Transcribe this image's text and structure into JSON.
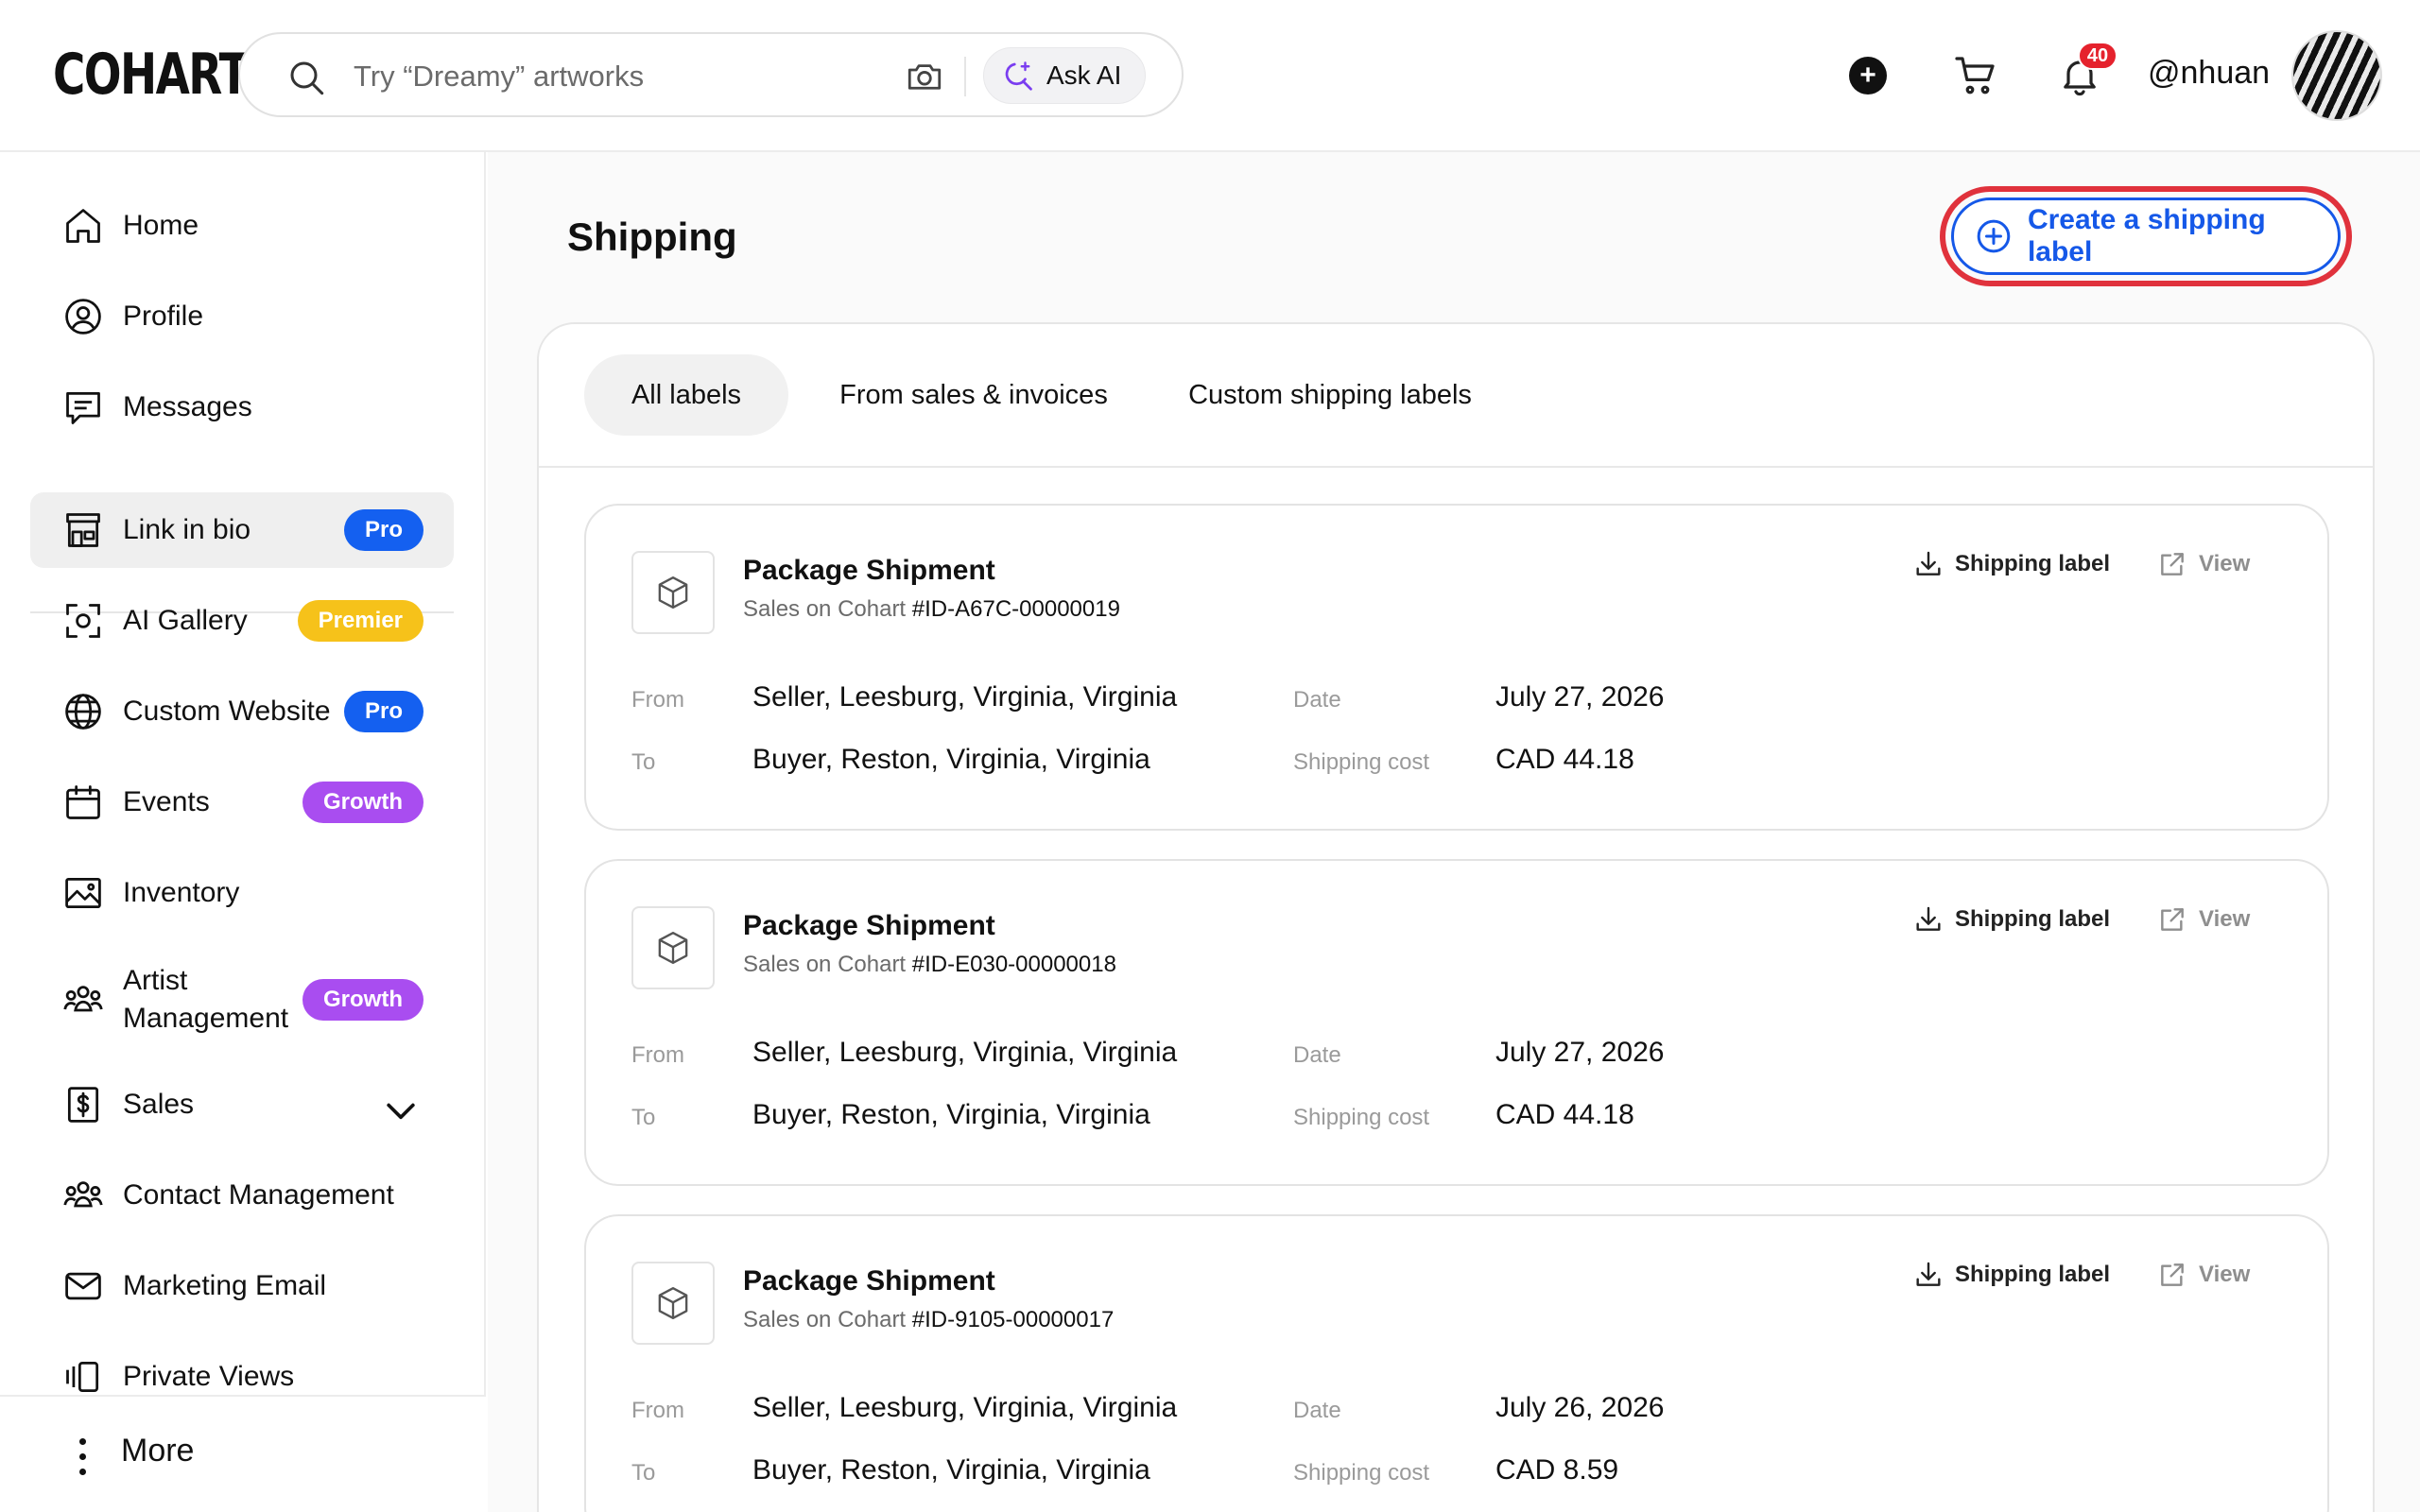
{
  "header": {
    "logo": "COHART",
    "search_placeholder": "Try “Dreamy” artworks",
    "ask_ai_label": "Ask AI",
    "notification_count": "40",
    "username": "@nhuan"
  },
  "sidebar": {
    "items": [
      {
        "label": "Home",
        "icon": "home-icon"
      },
      {
        "label": "Profile",
        "icon": "profile-icon"
      },
      {
        "label": "Messages",
        "icon": "messages-icon"
      },
      {
        "label": "Link in bio",
        "icon": "storefront-icon",
        "badge": "Pro"
      },
      {
        "label": "AI Gallery",
        "icon": "ai-gallery-icon",
        "badge": "Premier"
      },
      {
        "label": "Custom Website",
        "icon": "globe-icon",
        "badge": "Pro"
      },
      {
        "label": "Events",
        "icon": "calendar-icon",
        "badge": "Growth"
      },
      {
        "label": "Inventory",
        "icon": "image-icon"
      },
      {
        "label_line1": "Artist",
        "label_line2": "Management",
        "icon": "people-icon",
        "badge": "Growth"
      },
      {
        "label": "Sales",
        "icon": "dollar-icon"
      },
      {
        "label": "Contact Management",
        "icon": "contacts-icon"
      },
      {
        "label": "Marketing Email",
        "icon": "mail-icon"
      },
      {
        "label": "Private Views",
        "icon": "private-views-icon"
      }
    ],
    "more_label": "More"
  },
  "main": {
    "title": "Shipping",
    "create_button": "Create a shipping label",
    "tabs": [
      "All labels",
      "From sales & invoices",
      "Custom shipping labels"
    ],
    "field_labels": {
      "from": "From",
      "to": "To",
      "date": "Date",
      "cost": "Shipping cost"
    },
    "action_labels": {
      "download": "Shipping label",
      "view": "View"
    },
    "shipments": [
      {
        "title": "Package Shipment",
        "source": "Sales on Cohart",
        "ref": "#ID-A67C-00000019",
        "from": "Seller, Leesburg, Virginia, Virginia",
        "to": "Buyer, Reston, Virginia, Virginia",
        "date": "July 27, 2026",
        "cost": "CAD 44.18"
      },
      {
        "title": "Package Shipment",
        "source": "Sales on Cohart",
        "ref": "#ID-E030-00000018",
        "from": "Seller, Leesburg, Virginia, Virginia",
        "to": "Buyer, Reston, Virginia, Virginia",
        "date": "July 27, 2026",
        "cost": "CAD 44.18"
      },
      {
        "title": "Package Shipment",
        "source": "Sales on Cohart",
        "ref": "#ID-9105-00000017",
        "from": "Seller, Leesburg, Virginia, Virginia",
        "to": "Buyer, Reston, Virginia, Virginia",
        "date": "July 26, 2026",
        "cost": "CAD 8.59"
      }
    ]
  }
}
